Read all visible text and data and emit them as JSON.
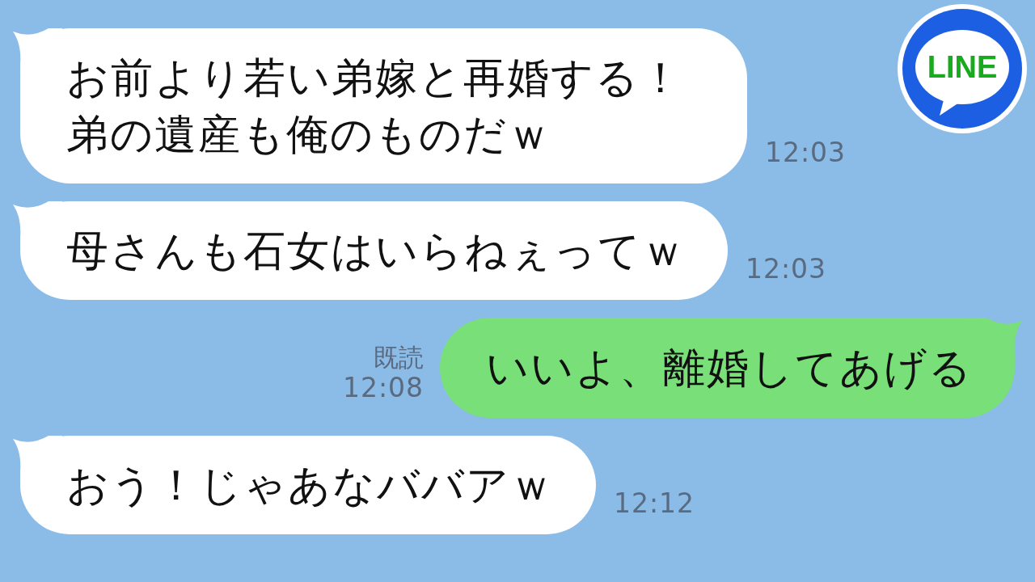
{
  "logo": {
    "text": "LINE"
  },
  "messages": [
    {
      "kind": "received",
      "text": "お前より若い弟嫁と再婚する！弟の遺産も俺のものだｗ",
      "time": "12:03"
    },
    {
      "kind": "received",
      "text": "母さんも石女はいらねぇってｗ",
      "time": "12:03"
    },
    {
      "kind": "sent",
      "read_receipt": "既読",
      "text": "いいよ、離婚してあげる",
      "time": "12:08"
    },
    {
      "kind": "received",
      "text": "おう！じゃあなババアｗ",
      "time": "12:12"
    }
  ]
}
